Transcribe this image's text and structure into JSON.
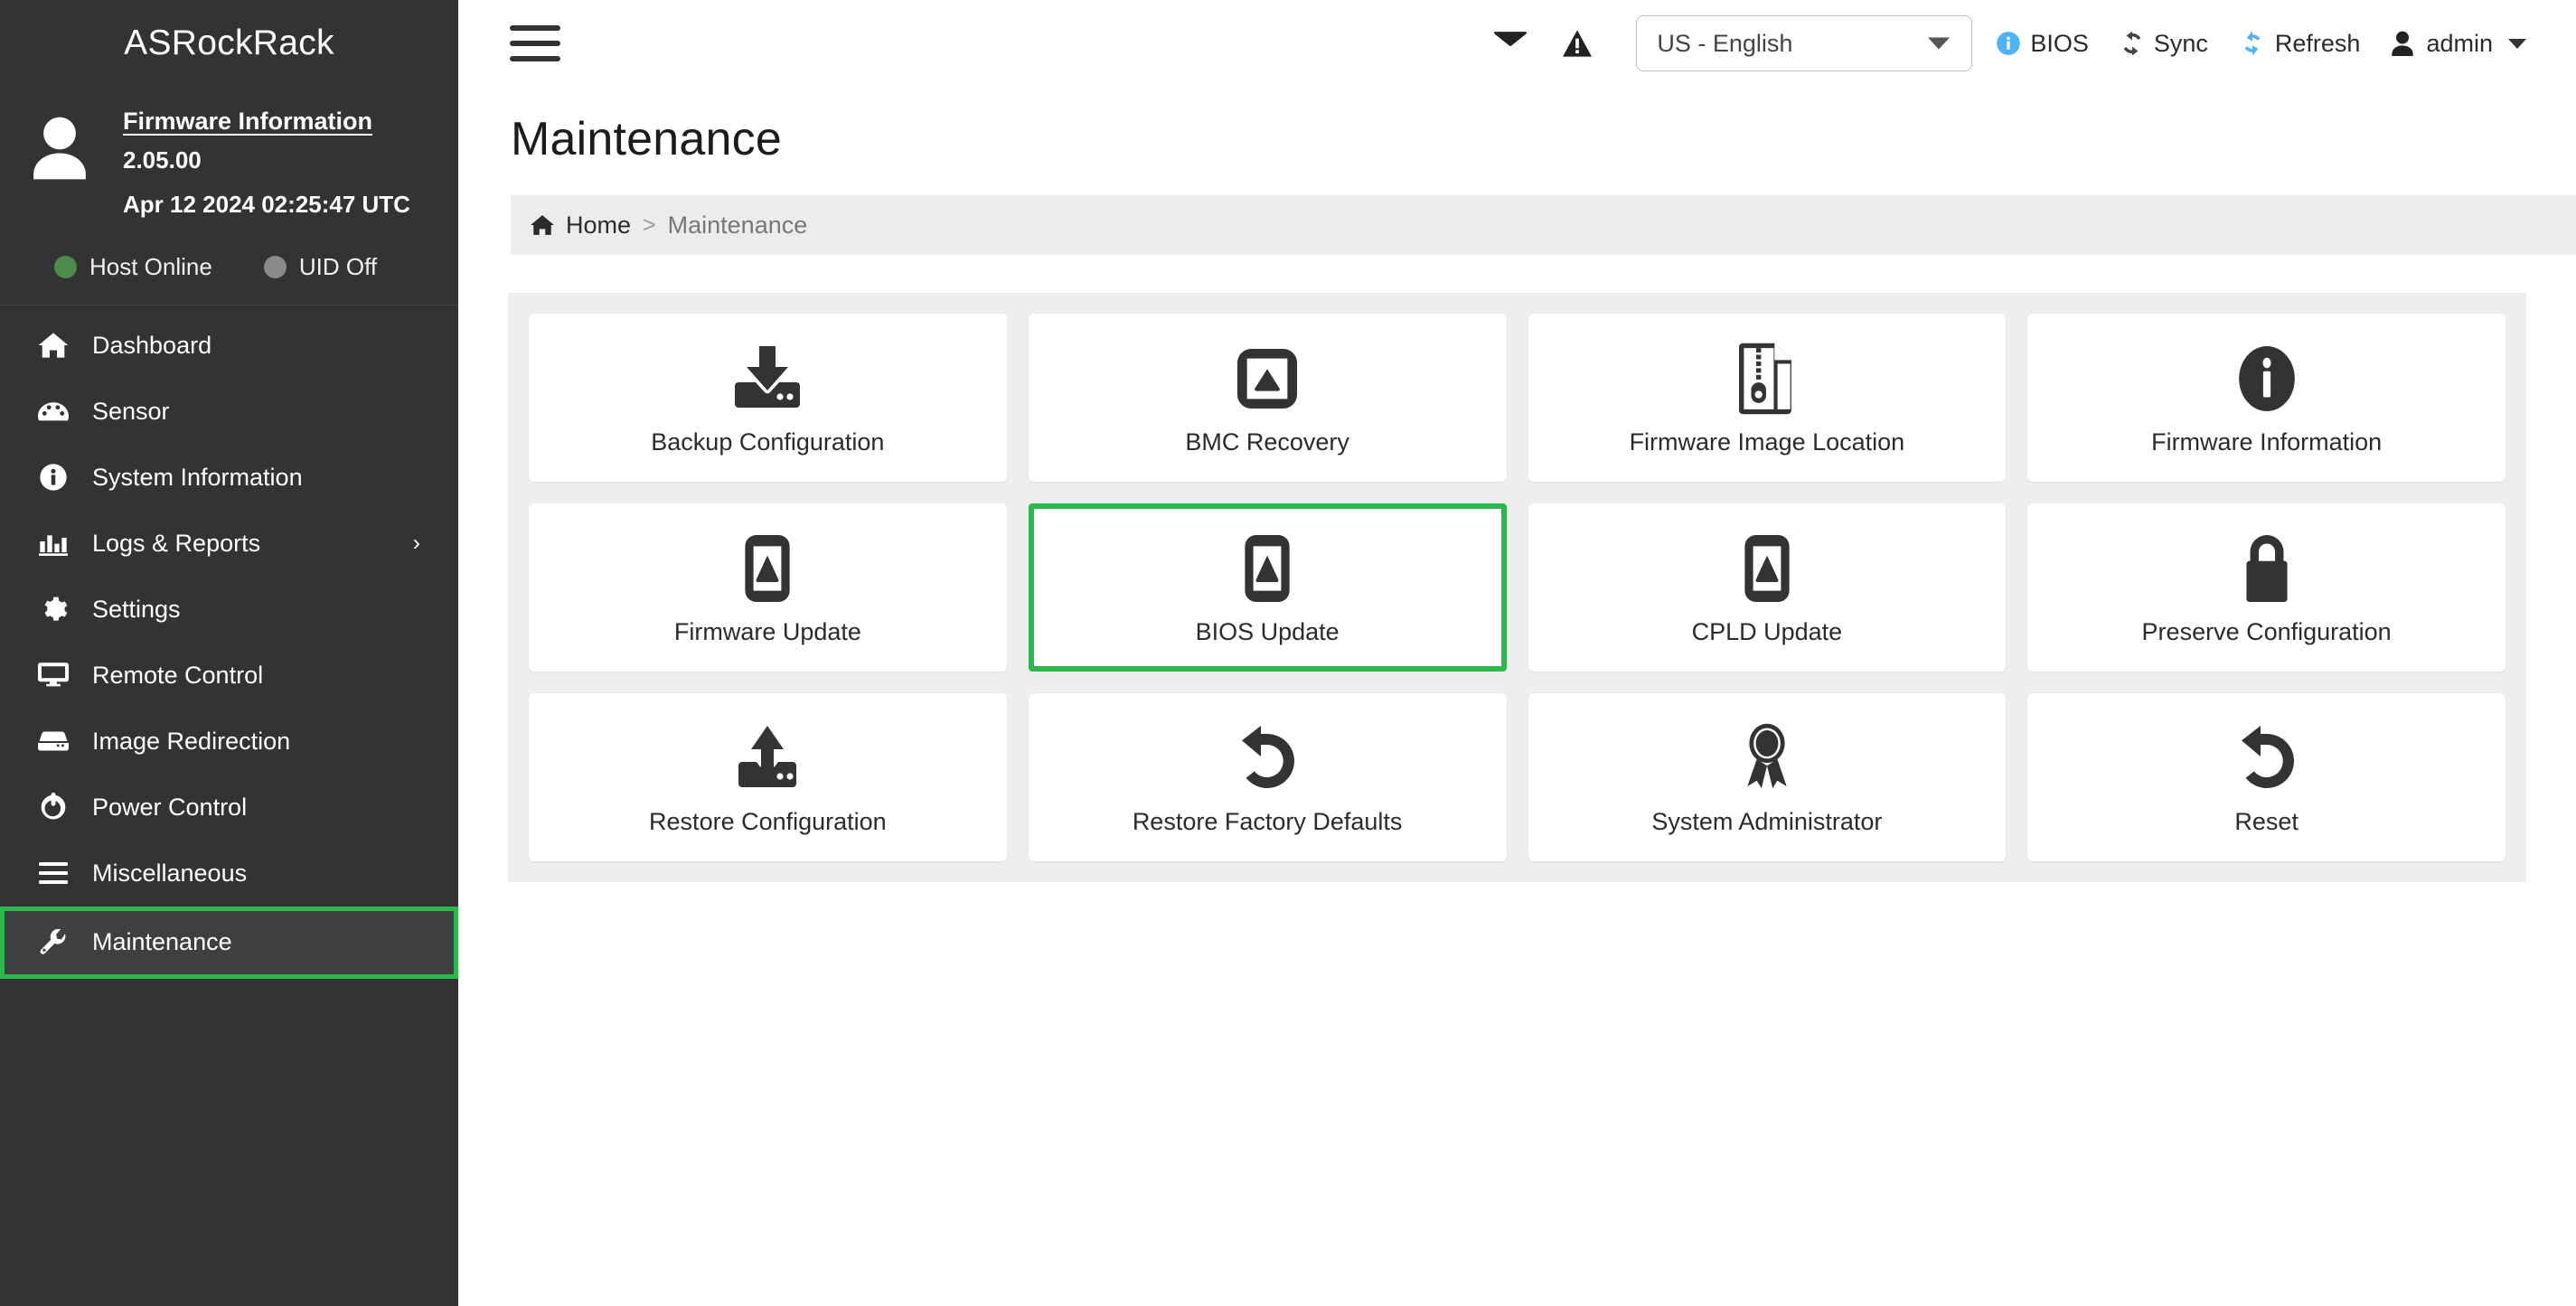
{
  "sidebar": {
    "brand": "ASRockRack",
    "firmware": {
      "title": "Firmware Information",
      "version": "2.05.00",
      "build_date": "Apr 12 2024 02:25:47 UTC"
    },
    "status": [
      {
        "label": "Host Online",
        "icon": "status-dot-green",
        "color": "#4c8c4a"
      },
      {
        "label": "UID Off",
        "icon": "status-dot-gray",
        "color": "#8a8a8a"
      }
    ],
    "items": [
      {
        "label": "Dashboard",
        "icon": "home-icon",
        "active": false,
        "has_submenu": false
      },
      {
        "label": "Sensor",
        "icon": "gauge-icon",
        "active": false,
        "has_submenu": false
      },
      {
        "label": "System Information",
        "icon": "info-circle-icon",
        "active": false,
        "has_submenu": false
      },
      {
        "label": "Logs & Reports",
        "icon": "bar-chart-icon",
        "active": false,
        "has_submenu": true
      },
      {
        "label": "Settings",
        "icon": "gear-icon",
        "active": false,
        "has_submenu": false
      },
      {
        "label": "Remote Control",
        "icon": "monitor-icon",
        "active": false,
        "has_submenu": false
      },
      {
        "label": "Image Redirection",
        "icon": "drive-icon",
        "active": false,
        "has_submenu": false
      },
      {
        "label": "Power Control",
        "icon": "power-icon",
        "active": false,
        "has_submenu": false
      },
      {
        "label": "Miscellaneous",
        "icon": "list-icon",
        "active": false,
        "has_submenu": false
      },
      {
        "label": "Maintenance",
        "icon": "wrench-icon",
        "active": true,
        "has_submenu": false
      }
    ],
    "submenu_chevron": "›"
  },
  "topbar": {
    "menu_toggle_icon": "hamburger-icon",
    "mail_icon": "envelope-icon",
    "alert_icon": "warning-triangle-icon",
    "language": {
      "value": "US - English",
      "caret_icon": "chevron-down-icon"
    },
    "bios_label": "BIOS",
    "sync_label": "Sync",
    "refresh_label": "Refresh",
    "user_label": "admin",
    "colors": {
      "accent_blue": "#4eb3f5",
      "refresh_blue": "#4eb3f5"
    }
  },
  "page": {
    "title": "Maintenance",
    "breadcrumb": {
      "home_label": "Home",
      "separator": ">",
      "current_label": "Maintenance"
    }
  },
  "tiles": [
    {
      "label": "Backup Configuration",
      "icon": "download-tray-icon",
      "selected": false
    },
    {
      "label": "BMC Recovery",
      "icon": "update-square-icon",
      "selected": false
    },
    {
      "label": "Firmware Image Location",
      "icon": "file-archive-icon",
      "selected": false
    },
    {
      "label": "Firmware Information",
      "icon": "info-filled-icon",
      "selected": false
    },
    {
      "label": "Firmware Update",
      "icon": "update-device-icon",
      "selected": false
    },
    {
      "label": "BIOS Update",
      "icon": "update-device-icon",
      "selected": true
    },
    {
      "label": "CPLD Update",
      "icon": "update-device-icon",
      "selected": false
    },
    {
      "label": "Preserve Configuration",
      "icon": "lock-icon",
      "selected": false
    },
    {
      "label": "Restore Configuration",
      "icon": "upload-tray-icon",
      "selected": false
    },
    {
      "label": "Restore Factory Defaults",
      "icon": "undo-icon",
      "selected": false
    },
    {
      "label": "System Administrator",
      "icon": "award-ribbon-icon",
      "selected": false
    },
    {
      "label": "Reset",
      "icon": "undo-icon",
      "selected": false
    }
  ],
  "theme": {
    "sidebar_bg": "#333333",
    "highlight_green": "#2cb84a",
    "panel_bg": "#eeeeee",
    "breadcrumb_bg": "#ececec"
  }
}
